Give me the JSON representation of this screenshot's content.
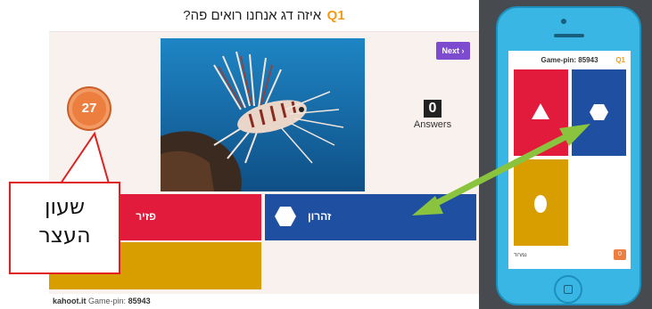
{
  "question": {
    "text": "?איזה דג אנחנו רואים פה",
    "number": "Q1"
  },
  "host": {
    "next_label": "Next ›",
    "timer": "27",
    "answers_count": "0",
    "answers_label": "Answers",
    "answer_red_label": "פזיר",
    "answer_blue_label": "זהרון",
    "footer_brand": "kahoot.it",
    "footer_pin_label": "Game-pin:",
    "footer_pin_value": "85943"
  },
  "callout": {
    "line1": "שעון",
    "line2": "העצר"
  },
  "phone": {
    "pin": "Game-pin: 85943",
    "question_num": "Q1",
    "bottom_label": "נמרוד",
    "score": "0"
  },
  "colors": {
    "red": "#e21b3c",
    "blue": "#1f4fa0",
    "gold": "#d89e00",
    "timer": "#ec7e3f",
    "next": "#7d4bd0",
    "arrow": "#8ac43f",
    "callout_border": "#e02020",
    "phone_body": "#39b6e4"
  },
  "icons": {
    "answer_blue": "hexagon-icon",
    "phone_red": "triangle-icon",
    "phone_blue": "hexagon-icon",
    "phone_gold": "circle-icon"
  }
}
